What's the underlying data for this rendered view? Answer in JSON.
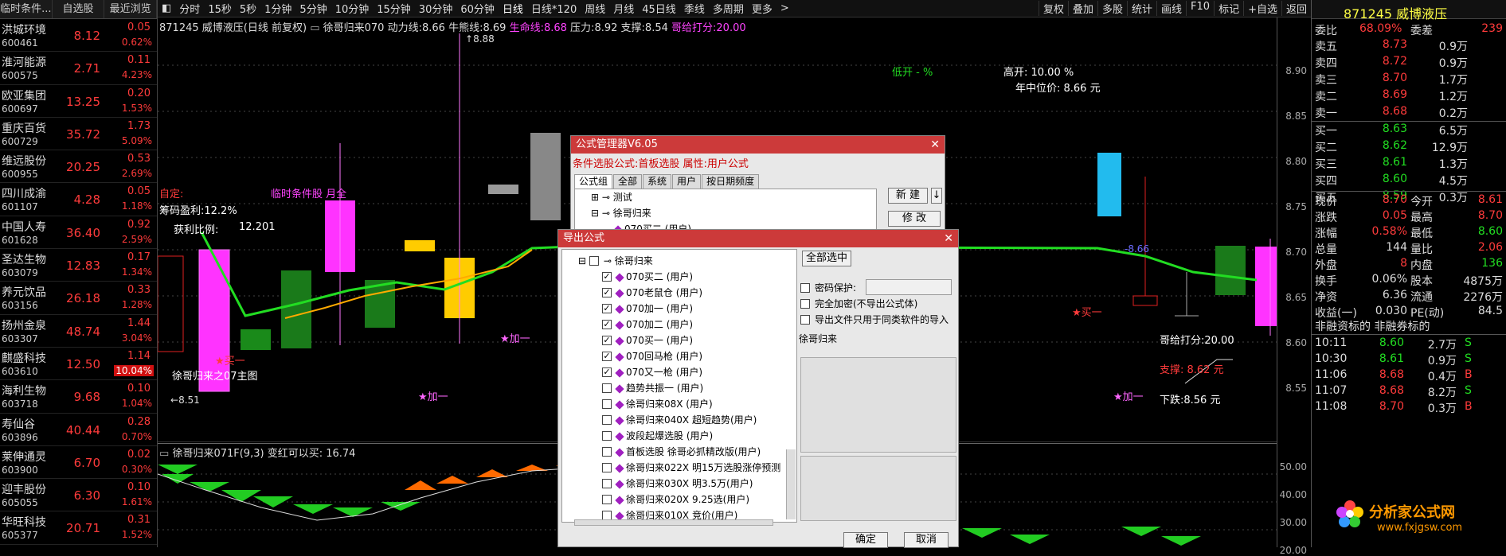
{
  "stock_list": {
    "headers": [
      "临时条件...",
      "自选股",
      "最近浏览"
    ],
    "rows": [
      {
        "name": "洪城环境",
        "code": "600461",
        "price": "8.12",
        "change": "0.05",
        "pct": "0.62%"
      },
      {
        "name": "淮河能源",
        "code": "600575",
        "price": "2.71",
        "change": "0.11",
        "pct": "4.23%"
      },
      {
        "name": "欧亚集团",
        "code": "600697",
        "price": "13.25",
        "change": "0.20",
        "pct": "1.53%"
      },
      {
        "name": "重庆百货",
        "code": "600729",
        "price": "35.72",
        "change": "1.73",
        "pct": "5.09%"
      },
      {
        "name": "维远股份",
        "code": "600955",
        "price": "20.25",
        "change": "0.53",
        "pct": "2.69%"
      },
      {
        "name": "四川成渝",
        "code": "601107",
        "price": "4.28",
        "change": "0.05",
        "pct": "1.18%"
      },
      {
        "name": "中国人寿",
        "code": "601628",
        "price": "36.40",
        "change": "0.92",
        "pct": "2.59%"
      },
      {
        "name": "圣达生物",
        "code": "603079",
        "price": "12.83",
        "change": "0.17",
        "pct": "1.34%"
      },
      {
        "name": "养元饮品",
        "code": "603156",
        "price": "26.18",
        "change": "0.33",
        "pct": "1.28%"
      },
      {
        "name": "扬州金泉",
        "code": "603307",
        "price": "48.74",
        "change": "1.44",
        "pct": "3.04%"
      },
      {
        "name": "麒盛科技",
        "code": "603610",
        "price": "12.50",
        "change": "1.14",
        "pct": "10.04%"
      },
      {
        "name": "海利生物",
        "code": "603718",
        "price": "9.68",
        "change": "0.10",
        "pct": "1.04%"
      },
      {
        "name": "寿仙谷",
        "code": "603896",
        "price": "40.44",
        "change": "0.28",
        "pct": "0.70%"
      },
      {
        "name": "莱伸通灵",
        "code": "603900",
        "price": "6.70",
        "change": "0.02",
        "pct": "0.30%"
      },
      {
        "name": "迎丰股份",
        "code": "605055",
        "price": "6.30",
        "change": "0.10",
        "pct": "1.61%"
      },
      {
        "name": "华旺科技",
        "code": "605377",
        "price": "20.71",
        "change": "0.31",
        "pct": "1.52%"
      }
    ]
  },
  "toolbar": {
    "periods": [
      "分时",
      "15秒",
      "5秒",
      "1分钟",
      "5分钟",
      "10分钟",
      "15分钟",
      "30分钟",
      "60分钟",
      "日线",
      "日线*120",
      "周线",
      "月线",
      "45日线",
      "季线",
      "多周期",
      "更多"
    ],
    "right_buttons": [
      "复权",
      "叠加",
      "多股",
      "统计",
      "画线",
      "F10",
      "标记",
      "+自选",
      "返回"
    ]
  },
  "info_line": {
    "title": "871245 威博液压(日线 前复权)",
    "formula": "徐哥归来070",
    "power_label": "动力线:",
    "power": "8.66",
    "bull_label": "牛熊线:",
    "bull": "8.69",
    "life_label": "生命线:",
    "life": "8.68",
    "pressure_label": "压力:",
    "pressure": "8.92",
    "support_label": "支撑:",
    "support": "8.54",
    "score_label": "哥给打分:",
    "score": "20.00"
  },
  "chart_labels": {
    "high_mark": "8.88",
    "low_mark": "8.51",
    "zixuan": "自定:",
    "chip_profit": "筹码盈利:12.2%",
    "profit_ratio": "获利比例:",
    "profit_ratio_value": "12.201",
    "temp_condition": "临时条件股 月全",
    "low_open": "低开 - %",
    "high_open": "高开: 10.00 %",
    "year_mid": "年中位价: 8.66 元",
    "main_chart_name": "徐哥归来之07主图",
    "add_one_1": "★加一",
    "add_one_2": "★加一",
    "add_one_3": "★加一",
    "buy_one": "★买一",
    "buy_one_2": "★买一",
    "score_text": "哥给打分:20.00",
    "support_text": "支撑: 8.62 元",
    "fall_text": "下跌:8.56 元",
    "line_value": "8.66",
    "sub_title": "徐哥归来071F(9,3)",
    "sub_text": "变红可以买: 16.74"
  },
  "y_axis": {
    "ticks": [
      "8.90",
      "8.85",
      "8.80",
      "8.75",
      "8.70",
      "8.65",
      "8.60",
      "8.55",
      "50.00",
      "40.00",
      "30.00",
      "20.00"
    ]
  },
  "quote": {
    "title": "871245 威博液压",
    "weibi_label": "委比",
    "weibi": "68.09%",
    "weicha_label": "委差",
    "weicha": "239",
    "asks": [
      {
        "label": "卖五",
        "price": "8.73",
        "vol": "0.9万"
      },
      {
        "label": "卖四",
        "price": "8.72",
        "vol": "0.9万"
      },
      {
        "label": "卖三",
        "price": "8.70",
        "vol": "1.7万"
      },
      {
        "label": "卖二",
        "price": "8.69",
        "vol": "1.2万"
      },
      {
        "label": "卖一",
        "price": "8.68",
        "vol": "0.2万"
      }
    ],
    "bids": [
      {
        "label": "买一",
        "price": "8.63",
        "vol": "6.5万"
      },
      {
        "label": "买二",
        "price": "8.62",
        "vol": "12.9万"
      },
      {
        "label": "买三",
        "price": "8.61",
        "vol": "1.3万"
      },
      {
        "label": "买四",
        "price": "8.60",
        "vol": "4.5万"
      },
      {
        "label": "买五",
        "price": "8.59",
        "vol": "0.3万"
      }
    ],
    "stats": [
      {
        "l1": "现价",
        "v1": "8.70",
        "l2": "今开",
        "v2": "8.61"
      },
      {
        "l1": "涨跌",
        "v1": "0.05",
        "l2": "最高",
        "v2": "8.70"
      },
      {
        "l1": "涨幅",
        "v1": "0.58%",
        "l2": "最低",
        "v2": "8.60"
      },
      {
        "l1": "总量",
        "v1": "144",
        "l2": "量比",
        "v2": "2.06"
      },
      {
        "l1": "外盘",
        "v1": "8",
        "l2": "内盘",
        "v2": "136"
      },
      {
        "l1": "换手",
        "v1": "0.06%",
        "l2": "股本",
        "v2": "4875万"
      },
      {
        "l1": "净资",
        "v1": "6.36",
        "l2": "流通",
        "v2": "2276万"
      },
      {
        "l1": "收益(一)",
        "v1": "0.030",
        "l2": "PE(动)",
        "v2": "84.5"
      }
    ],
    "nonfin": "非融资标的 非融券标的",
    "ticks": [
      {
        "time": "10:11",
        "price": "8.60",
        "vol": "2.7万",
        "side": "S"
      },
      {
        "time": "10:30",
        "price": "8.61",
        "vol": "0.9万",
        "side": "S"
      },
      {
        "time": "11:06",
        "price": "8.68",
        "vol": "0.4万",
        "side": "B"
      },
      {
        "time": "11:07",
        "price": "8.68",
        "vol": "8.2万",
        "side": "S"
      },
      {
        "time": "11:08",
        "price": "8.70",
        "vol": "0.3万",
        "side": "B"
      }
    ],
    "logo_text": "分析家公式网",
    "logo_url": "www.fxjgsw.com"
  },
  "formula_manager": {
    "title": "公式管理器V6.05",
    "subtitle": "条件选股公式:首板选股 属性:用户公式",
    "tabs": [
      "公式组",
      "全部",
      "系统",
      "用户",
      "按日期频度"
    ],
    "tree": [
      "测试",
      "徐哥归来",
      "070买二 (用户)"
    ],
    "new_button": "新 建",
    "edit_button": "修 改"
  },
  "export_dialog": {
    "title": "导出公式",
    "root": "徐哥归来",
    "items": [
      {
        "label": "070买二 (用户)",
        "checked": true
      },
      {
        "label": "070老鼠仓 (用户)",
        "checked": true
      },
      {
        "label": "070加一 (用户)",
        "checked": true
      },
      {
        "label": "070加二 (用户)",
        "checked": true
      },
      {
        "label": "070买一 (用户)",
        "checked": true
      },
      {
        "label": "070回马枪 (用户)",
        "checked": true
      },
      {
        "label": "070又一枪 (用户)",
        "checked": true
      },
      {
        "label": "趋势共振一 (用户)",
        "checked": false
      },
      {
        "label": "徐哥归来08X (用户)",
        "checked": false
      },
      {
        "label": "徐哥归来040X 超短趋势(用户)",
        "checked": false
      },
      {
        "label": "波段起爆选股 (用户)",
        "checked": false
      },
      {
        "label": "首板选股 徐哥必抓精改版(用户)",
        "checked": false
      },
      {
        "label": "徐哥归来022X 明15万选股涨停预测",
        "checked": false
      },
      {
        "label": "徐哥归来030X 明3.5万(用户)",
        "checked": false
      },
      {
        "label": "徐哥归来020X 9.25选(用户)",
        "checked": false
      },
      {
        "label": "徐哥归来010X 竞价(用户)",
        "checked": false
      }
    ],
    "select_all": "全部选中",
    "password_label": "密码保护:",
    "full_encrypt": "完全加密(不导出公式体)",
    "same_type_only": "导出文件只用于同类软件的导入",
    "desc": "徐哥归来",
    "ok": "确定",
    "cancel": "取消"
  }
}
